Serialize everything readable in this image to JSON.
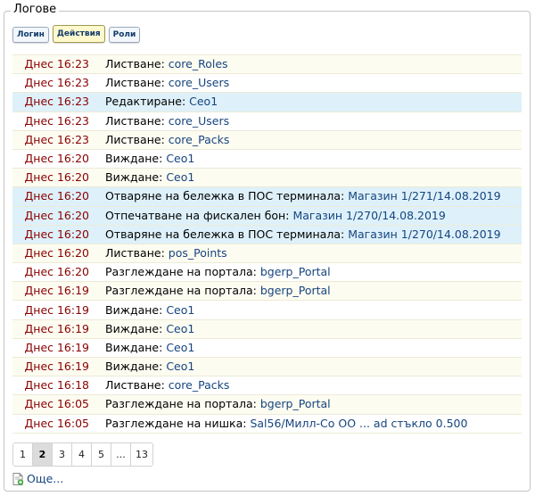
{
  "panel": {
    "title": "Логове",
    "tabs": [
      {
        "label": "Логин",
        "active": false
      },
      {
        "label": "Действия",
        "active": true
      },
      {
        "label": "Роли",
        "active": false
      }
    ]
  },
  "log_rows": [
    {
      "time": "Днес 16:23",
      "action": "Листване:",
      "link": "core_Roles",
      "highlight": false
    },
    {
      "time": "Днес 16:23",
      "action": "Листване:",
      "link": "core_Users",
      "highlight": false
    },
    {
      "time": "Днес 16:23",
      "action": "Редактиране:",
      "link": "Ceo1",
      "highlight": true
    },
    {
      "time": "Днес 16:23",
      "action": "Листване:",
      "link": "core_Users",
      "highlight": false
    },
    {
      "time": "Днес 16:23",
      "action": "Листване:",
      "link": "core_Packs",
      "highlight": false
    },
    {
      "time": "Днес 16:20",
      "action": "Виждане:",
      "link": "Ceo1",
      "highlight": false
    },
    {
      "time": "Днес 16:20",
      "action": "Виждане:",
      "link": "Ceo1",
      "highlight": false
    },
    {
      "time": "Днес 16:20",
      "action": "Отваряне на бележка в ПОС терминала:",
      "link": "Магазин 1/271/14.08.2019",
      "highlight": true
    },
    {
      "time": "Днес 16:20",
      "action": "Отпечатване на фискален бон:",
      "link": "Магазин 1/270/14.08.2019",
      "highlight": true
    },
    {
      "time": "Днес 16:20",
      "action": "Отваряне на бележка в ПОС терминала:",
      "link": "Магазин 1/270/14.08.2019",
      "highlight": true
    },
    {
      "time": "Днес 16:20",
      "action": "Листване:",
      "link": "pos_Points",
      "highlight": false
    },
    {
      "time": "Днес 16:20",
      "action": "Разглеждане на портала:",
      "link": "bgerp_Portal",
      "highlight": false
    },
    {
      "time": "Днес 16:19",
      "action": "Разглеждане на портала:",
      "link": "bgerp_Portal",
      "highlight": false
    },
    {
      "time": "Днес 16:19",
      "action": "Виждане:",
      "link": "Ceo1",
      "highlight": false
    },
    {
      "time": "Днес 16:19",
      "action": "Виждане:",
      "link": "Ceo1",
      "highlight": false
    },
    {
      "time": "Днес 16:19",
      "action": "Виждане:",
      "link": "Ceo1",
      "highlight": false
    },
    {
      "time": "Днес 16:19",
      "action": "Виждане:",
      "link": "Ceo1",
      "highlight": false
    },
    {
      "time": "Днес 16:18",
      "action": "Листване:",
      "link": "core_Packs",
      "highlight": false
    },
    {
      "time": "Днес 16:05",
      "action": "Разглеждане на портала:",
      "link": "bgerp_Portal",
      "highlight": false
    },
    {
      "time": "Днес 16:05",
      "action": "Разглеждане на нишка:",
      "link": "Sal56/Милл-Со ОО ... ad стъкло 0.500",
      "highlight": false
    }
  ],
  "pagination": {
    "pages": [
      "1",
      "2",
      "3",
      "4",
      "5",
      "...",
      "13"
    ],
    "current": "2"
  },
  "more": {
    "label": "Още...",
    "icon": "page-add-icon"
  },
  "colors": {
    "time": "#8a0000",
    "link": "#16447f",
    "highlight_row": "#def1fa",
    "odd_row": "#fdfcf1"
  }
}
